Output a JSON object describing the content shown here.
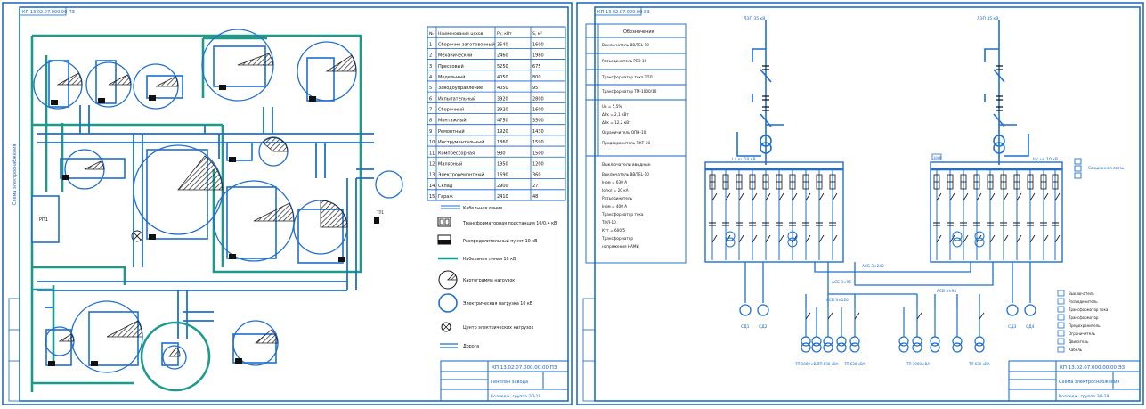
{
  "left_sheet": {
    "stamp": "КП 13.02.07.000.00 ПЗ",
    "title_block": {
      "code": "КП 13.02.07.000.00.00 ПЗ",
      "name": "Генплан завода",
      "org": "Колледж, группа ЭЛ-19"
    },
    "rp_label": "РП1",
    "tp_label": "ТП1",
    "side_label": "Схема электроснабжения",
    "table": {
      "headers": [
        "№",
        "Наименование цехов",
        "Ру, кВт",
        "S, м²"
      ],
      "rows": [
        [
          "1",
          "Сборочно-заготовочный",
          "3540",
          "1600"
        ],
        [
          "2",
          "Механический",
          "2460",
          "1980"
        ],
        [
          "3",
          "Прессовый",
          "5250",
          "675"
        ],
        [
          "4",
          "Модельный",
          "4050",
          "800"
        ],
        [
          "5",
          "Заводоуправление",
          "4050",
          "95"
        ],
        [
          "6",
          "Испытательный",
          "3920",
          "2800"
        ],
        [
          "7",
          "Сборочный",
          "3920",
          "1600"
        ],
        [
          "8",
          "Монтажный",
          "4750",
          "3500"
        ],
        [
          "9",
          "Ремонтный",
          "1920",
          "1430"
        ],
        [
          "10",
          "Инструментальный",
          "1860",
          "1590"
        ],
        [
          "11",
          "Компрессорная",
          "930",
          "1500"
        ],
        [
          "12",
          "Малярный",
          "1950",
          "1200"
        ],
        [
          "13",
          "Электроремонтный",
          "1690",
          "360"
        ],
        [
          "14",
          "Склад",
          "2900",
          "27"
        ],
        [
          "15",
          "Гараж",
          "2410",
          "48"
        ]
      ]
    },
    "legend": [
      "Кабельная линия",
      "Трансформаторная подстанция 10/0,4 кВ",
      "Распределительный пункт 10 кВ",
      "Кабельная линия 10 кВ",
      "Картограмма нагрузок",
      "Электрическая нагрузка 10 кВ",
      "Центр электрических нагрузок",
      "Дорога"
    ]
  },
  "right_sheet": {
    "stamp": "КП 13.02.07.000.00 Э3",
    "title_block": {
      "code": "КП 13.02.07.000.00.00 Э3",
      "name": "Схема электроснабжения",
      "org": "Колледж, группа ЭЛ-19"
    },
    "notes_header": "Обозначения",
    "notes": [
      "Выключатель ВВ/TEL-10",
      "Разъединитель РВЗ-10",
      "Трансформатор тока ТПЛ",
      "Трансформатор ТМ-1000/10",
      "Uк = 5,5%",
      "ΔPх = 2,1 кВт",
      "ΔPк = 12,2 кВт",
      "Ограничитель ОПН-10",
      "Предохранитель ПКТ-10"
    ],
    "equip_header": "Выключатели вводные",
    "equip": [
      "Выключатель ВВ/TEL-10",
      "Iном = 630 А",
      "Iоткл = 20 кА",
      "Разъединитель",
      "Iном = 400 А",
      "Трансформатор тока",
      "ТОЛ-10",
      "Ктт = 600/5",
      "Трансформатор",
      "напряжения НАМИ"
    ],
    "bus_labels": [
      "I с.ш. 10 кВ",
      "II с.ш. 10 кВ"
    ],
    "bus_left_tag": "10кВ",
    "bus_right_tag": "10кВ",
    "bus_connection": "Секционная связь",
    "tie_labels": [
      "АСБ 3×240",
      "АСБ 3×95",
      "АСБ 3×95",
      "АСБ 3×120"
    ],
    "feeder_top": [
      "ЛЭП 35 кВ",
      "ЛЭП 35 кВ"
    ],
    "motor_labels": [
      "СД1",
      "СД2",
      "СД3",
      "СД4"
    ],
    "tp_labels": [
      "ТП 1000 кВА",
      "ТП 630 кВА",
      "ТП 630 кВА",
      "ТП 1000 кВА",
      "ТП 630 кВА"
    ],
    "legend_right": [
      "Выключатель",
      "Разъединитель",
      "Трансформатор тока",
      "Трансформатор",
      "Предохранитель",
      "Ограничитель",
      "Двигатель",
      "Кабель"
    ]
  },
  "colors": {
    "blue": "#1e6fd0",
    "teal": "#1a9b8c",
    "hatch": "#222222",
    "frame": "#1565c0"
  }
}
